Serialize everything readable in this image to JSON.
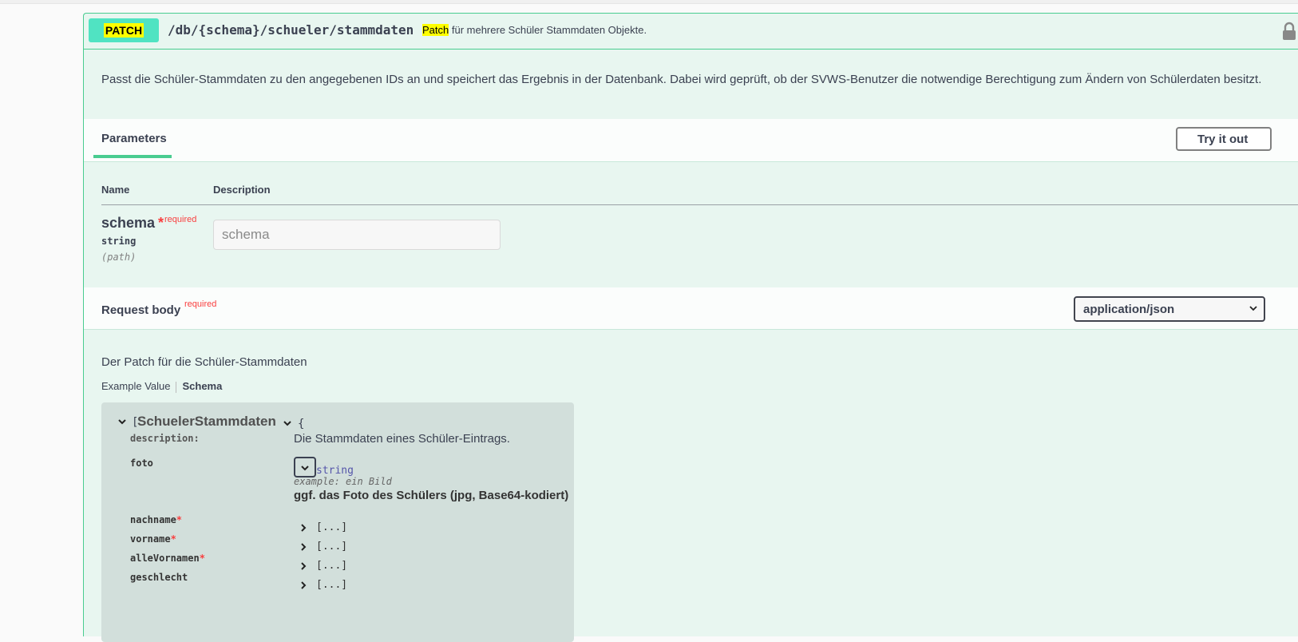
{
  "operation": {
    "method": "PATCH",
    "path": "/db/{schema}/schueler/stammdaten",
    "summary_highlight": "Patch",
    "summary_rest": " für mehrere Schüler Stammdaten Objekte.",
    "description": "Passt die Schüler-Stammdaten zu den angegebenen IDs an und speichert das Ergebnis in der Datenbank. Dabei wird geprüft, ob der SVWS-Benutzer die notwendige Berechtigung zum Ändern von Schülerdaten besitzt.",
    "colors": {
      "accent": "#49cc90",
      "method_bg": "#50e3c2",
      "highlight": "#ffff00",
      "required": "#f93e3e"
    }
  },
  "parameters": {
    "tab_label": "Parameters",
    "try_it_out": "Try it out",
    "col_name": "Name",
    "col_description": "Description",
    "items": [
      {
        "name": "schema",
        "required_star": "*",
        "required_label": "required",
        "type": "string",
        "in": "(path)",
        "placeholder": "schema"
      }
    ]
  },
  "request_body": {
    "title": "Request body",
    "required_label": "required",
    "content_type": "application/json",
    "description": "Der Patch für die Schüler-Stammdaten",
    "tab_example": "Example Value",
    "tab_schema": "Schema"
  },
  "model": {
    "open_bracket": "[",
    "name": "SchuelerStammdaten",
    "brace": "{",
    "description_key": "description:",
    "description": "Die Stammdaten eines Schüler-Eintrags.",
    "foto": {
      "name": "foto",
      "type": "string",
      "example": "example: ein Bild",
      "description": "ggf. das Foto des Schülers (jpg, Base64-kodiert)"
    },
    "properties": [
      {
        "name": "nachname",
        "required": "*",
        "collapsed": "[...]"
      },
      {
        "name": "vorname",
        "required": "*",
        "collapsed": "[...]"
      },
      {
        "name": "alleVornamen",
        "required": "*",
        "collapsed": "[...]"
      },
      {
        "name": "geschlecht",
        "required": "",
        "collapsed": "[...]"
      }
    ]
  },
  "icons": [
    "lock-icon",
    "chevron-down-icon",
    "chevron-right-icon"
  ]
}
